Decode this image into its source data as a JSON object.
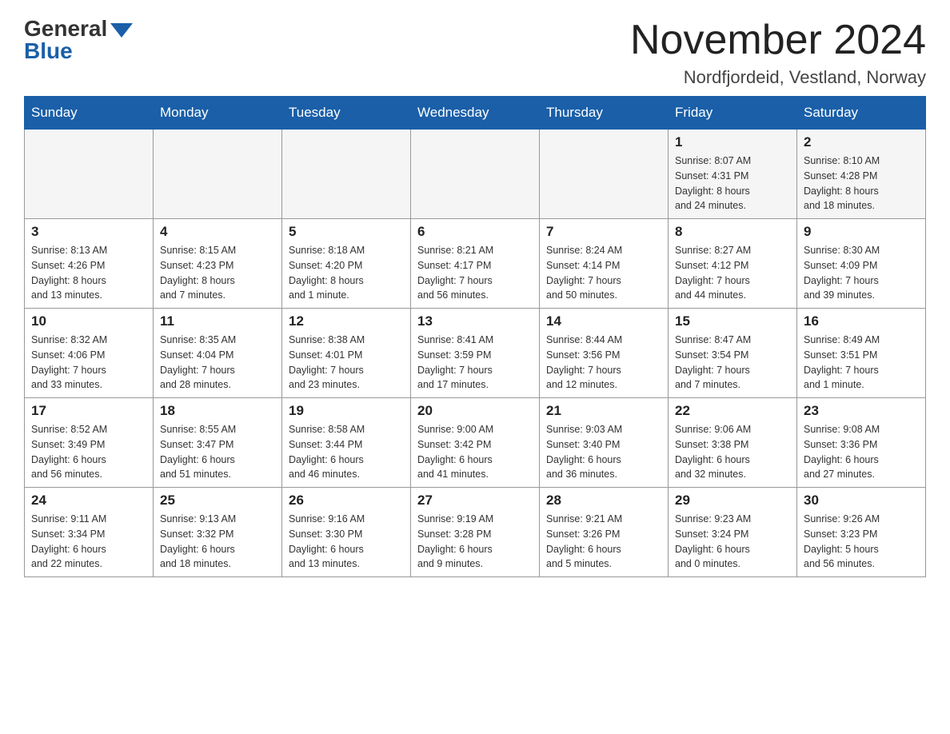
{
  "header": {
    "logo_general": "General",
    "logo_blue": "Blue",
    "month_title": "November 2024",
    "location": "Nordfjordeid, Vestland, Norway"
  },
  "weekdays": [
    "Sunday",
    "Monday",
    "Tuesday",
    "Wednesday",
    "Thursday",
    "Friday",
    "Saturday"
  ],
  "weeks": [
    [
      {
        "day": "",
        "info": ""
      },
      {
        "day": "",
        "info": ""
      },
      {
        "day": "",
        "info": ""
      },
      {
        "day": "",
        "info": ""
      },
      {
        "day": "",
        "info": ""
      },
      {
        "day": "1",
        "info": "Sunrise: 8:07 AM\nSunset: 4:31 PM\nDaylight: 8 hours\nand 24 minutes."
      },
      {
        "day": "2",
        "info": "Sunrise: 8:10 AM\nSunset: 4:28 PM\nDaylight: 8 hours\nand 18 minutes."
      }
    ],
    [
      {
        "day": "3",
        "info": "Sunrise: 8:13 AM\nSunset: 4:26 PM\nDaylight: 8 hours\nand 13 minutes."
      },
      {
        "day": "4",
        "info": "Sunrise: 8:15 AM\nSunset: 4:23 PM\nDaylight: 8 hours\nand 7 minutes."
      },
      {
        "day": "5",
        "info": "Sunrise: 8:18 AM\nSunset: 4:20 PM\nDaylight: 8 hours\nand 1 minute."
      },
      {
        "day": "6",
        "info": "Sunrise: 8:21 AM\nSunset: 4:17 PM\nDaylight: 7 hours\nand 56 minutes."
      },
      {
        "day": "7",
        "info": "Sunrise: 8:24 AM\nSunset: 4:14 PM\nDaylight: 7 hours\nand 50 minutes."
      },
      {
        "day": "8",
        "info": "Sunrise: 8:27 AM\nSunset: 4:12 PM\nDaylight: 7 hours\nand 44 minutes."
      },
      {
        "day": "9",
        "info": "Sunrise: 8:30 AM\nSunset: 4:09 PM\nDaylight: 7 hours\nand 39 minutes."
      }
    ],
    [
      {
        "day": "10",
        "info": "Sunrise: 8:32 AM\nSunset: 4:06 PM\nDaylight: 7 hours\nand 33 minutes."
      },
      {
        "day": "11",
        "info": "Sunrise: 8:35 AM\nSunset: 4:04 PM\nDaylight: 7 hours\nand 28 minutes."
      },
      {
        "day": "12",
        "info": "Sunrise: 8:38 AM\nSunset: 4:01 PM\nDaylight: 7 hours\nand 23 minutes."
      },
      {
        "day": "13",
        "info": "Sunrise: 8:41 AM\nSunset: 3:59 PM\nDaylight: 7 hours\nand 17 minutes."
      },
      {
        "day": "14",
        "info": "Sunrise: 8:44 AM\nSunset: 3:56 PM\nDaylight: 7 hours\nand 12 minutes."
      },
      {
        "day": "15",
        "info": "Sunrise: 8:47 AM\nSunset: 3:54 PM\nDaylight: 7 hours\nand 7 minutes."
      },
      {
        "day": "16",
        "info": "Sunrise: 8:49 AM\nSunset: 3:51 PM\nDaylight: 7 hours\nand 1 minute."
      }
    ],
    [
      {
        "day": "17",
        "info": "Sunrise: 8:52 AM\nSunset: 3:49 PM\nDaylight: 6 hours\nand 56 minutes."
      },
      {
        "day": "18",
        "info": "Sunrise: 8:55 AM\nSunset: 3:47 PM\nDaylight: 6 hours\nand 51 minutes."
      },
      {
        "day": "19",
        "info": "Sunrise: 8:58 AM\nSunset: 3:44 PM\nDaylight: 6 hours\nand 46 minutes."
      },
      {
        "day": "20",
        "info": "Sunrise: 9:00 AM\nSunset: 3:42 PM\nDaylight: 6 hours\nand 41 minutes."
      },
      {
        "day": "21",
        "info": "Sunrise: 9:03 AM\nSunset: 3:40 PM\nDaylight: 6 hours\nand 36 minutes."
      },
      {
        "day": "22",
        "info": "Sunrise: 9:06 AM\nSunset: 3:38 PM\nDaylight: 6 hours\nand 32 minutes."
      },
      {
        "day": "23",
        "info": "Sunrise: 9:08 AM\nSunset: 3:36 PM\nDaylight: 6 hours\nand 27 minutes."
      }
    ],
    [
      {
        "day": "24",
        "info": "Sunrise: 9:11 AM\nSunset: 3:34 PM\nDaylight: 6 hours\nand 22 minutes."
      },
      {
        "day": "25",
        "info": "Sunrise: 9:13 AM\nSunset: 3:32 PM\nDaylight: 6 hours\nand 18 minutes."
      },
      {
        "day": "26",
        "info": "Sunrise: 9:16 AM\nSunset: 3:30 PM\nDaylight: 6 hours\nand 13 minutes."
      },
      {
        "day": "27",
        "info": "Sunrise: 9:19 AM\nSunset: 3:28 PM\nDaylight: 6 hours\nand 9 minutes."
      },
      {
        "day": "28",
        "info": "Sunrise: 9:21 AM\nSunset: 3:26 PM\nDaylight: 6 hours\nand 5 minutes."
      },
      {
        "day": "29",
        "info": "Sunrise: 9:23 AM\nSunset: 3:24 PM\nDaylight: 6 hours\nand 0 minutes."
      },
      {
        "day": "30",
        "info": "Sunrise: 9:26 AM\nSunset: 3:23 PM\nDaylight: 5 hours\nand 56 minutes."
      }
    ]
  ]
}
